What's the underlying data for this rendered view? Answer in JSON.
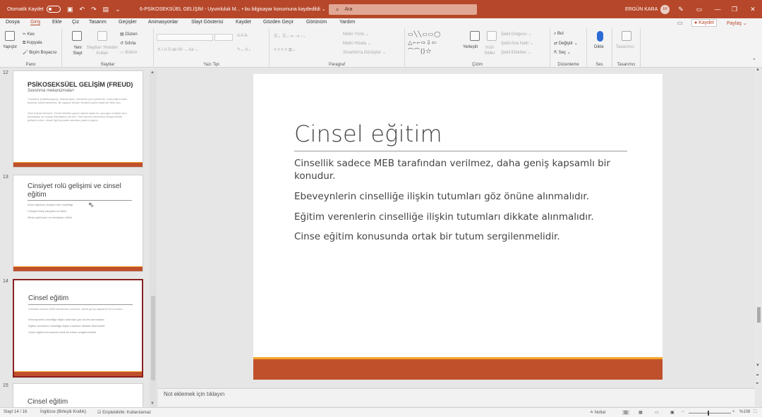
{
  "titlebar": {
    "autosave_label": "Otomatik Kaydet",
    "doc_title": "6-PSİKOSEKSÜEL GELİŞİM  -  Uyumluluk M...  •  bu bilgisayar konumuna kaydedildi ⌄",
    "search_placeholder": "Ara",
    "user_name": "ERGÜN KARA",
    "user_initials": "EK",
    "qat_icons": [
      "save-icon",
      "undo-icon",
      "redo-icon",
      "present-icon",
      "customize-icon"
    ]
  },
  "menu": {
    "tabs": [
      "Dosya",
      "Giriş",
      "Ekle",
      "Çiz",
      "Tasarım",
      "Geçişler",
      "Animasyonlar",
      "Slayt Gösterisi",
      "Kaydet",
      "Gözden Geçir",
      "Görünüm",
      "Yardım"
    ],
    "active_tab": "Giriş",
    "kaydet_button": "● Kaydet",
    "paylas_button": "Paylaş ⌄"
  },
  "ribbon": {
    "pano": {
      "label": "Pano",
      "paste": "Yapıştır",
      "cut": "Kes",
      "copy": "Kopyala",
      "format_painter": "Biçim Boyacısı"
    },
    "slaytlar": {
      "label": "Slaytlar",
      "new_slide": "Yeni Slayt",
      "reuse": "Slaytları Yeniden Kullan",
      "layout": "Düzen",
      "reset": "Sıfırla",
      "section": "Bölüm"
    },
    "yazi_tipi": {
      "label": "Yazı Tipi",
      "format_row": "K  /  A  S  ab  AV ⌄  Aa ⌄"
    },
    "paragraf": {
      "label": "Paragraf",
      "text_direction": "Metin Yönü ⌄",
      "align_text": "Metni Hizala ⌄",
      "smartart": "SmartArt'a Dönüştür ⌄"
    },
    "cizim": {
      "label": "Çizim",
      "arrange": "Yerleştir",
      "quick_styles": "Hızlı Stiller",
      "fill": "Şekil Dolgusu ⌄",
      "outline": "Şekil Ana Hattı ⌄",
      "effects": "Şekil Efektleri ⌄"
    },
    "duzenleme": {
      "label": "Düzenleme",
      "find": "Bul",
      "replace": "Değiştir ⌄",
      "select": "Seç ⌄"
    },
    "ses": {
      "label": "Ses",
      "dictate": "Dikte"
    },
    "tasarimci": {
      "label": "Tasarımcı",
      "designer": "Tasarımcı"
    }
  },
  "thumbnails": [
    {
      "number": "12",
      "title": "PSİKOSEKSÜEL GELİŞİM (FREUD)",
      "subtitle": "Savunma mekanizmaları",
      "para1": "Yüceltme (Süblimasyon): Davranışları, isteklerin yeni yönlerde, toplu kabul edilir biçimde yönlendirilmesi. Bu aşama bireyin kendini kabul edişinde etkili olur.",
      "para2": "Gizli Kalma Dönemi: Cinsel istekler geçici olarak bastırılır, çocuğun enerjisi okul, arkadaşlık ve sosyal etkinliklere yönelir. Gizil dönem süresince bireyin kimlik gelişimi sürer; cinsel ilgi dışındaki alanlara yatırım yapılır."
    },
    {
      "number": "13",
      "title": "Cinsiyet rolü gelişimi ve cinsel eğitim",
      "lines": [
        "Anne-babanın cinsiyet rolü modelliği",
        "Cinsiyet kalıp yargılarının etkisi",
        "Akran grubunun ve medyanın etkisi"
      ]
    },
    {
      "number": "14",
      "title": "Cinsel eğitim",
      "lines": [
        "Cinsellik sadece MEB tarafından verilmez, daha geniş kapsamlı bir konudur.",
        "Ebeveynlerin cinselliğe ilişkin tutumları göz önüne alınmalıdır.",
        "Eğitim verenlerin cinselliğe ilişkin tutumları dikkate alınmalıdır.",
        "Cinse eğitim konusunda ortak bir tutum sergilenmelidir."
      ]
    },
    {
      "number": "15",
      "title": "Cinsel eğitim"
    }
  ],
  "slide": {
    "title": "Cinsel eğitim",
    "bullets": [
      "Cinsellik sadece MEB tarafından verilmez, daha geniş kapsamlı bir konudur.",
      "Ebeveynlerin cinselliğe ilişkin tutumları göz önüne alınmalıdır.",
      "Eğitim verenlerin cinselliğe ilişkin tutumları dikkate alınmalıdır.",
      "Cinse eğitim konusunda ortak bir tutum sergilenmelidir."
    ]
  },
  "notes_placeholder": "Not eklemek için tıklayın",
  "status": {
    "slide_info": "Slayt 14 / 16",
    "language": "İngilizce (Birleşik Krallık)",
    "accessibility": "Erişilebilirlik: Kullanılamaz",
    "notes": "Notlar",
    "zoom": "%108"
  },
  "colors": {
    "accent": "#b7472a",
    "slide_bar": "#c0502c",
    "slide_bar_top": "#f4a72c"
  }
}
